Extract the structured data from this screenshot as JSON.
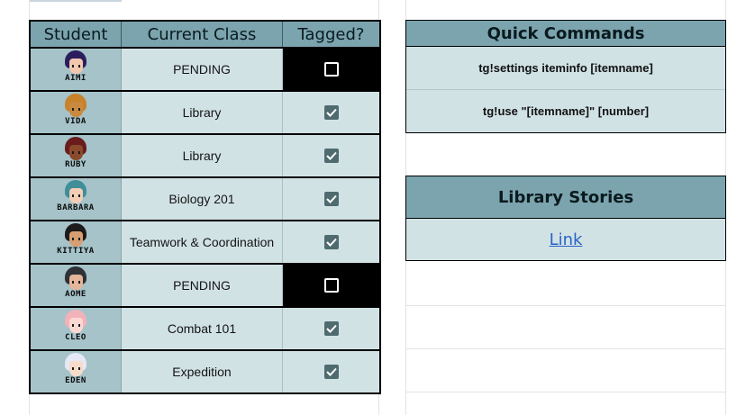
{
  "student_table": {
    "headers": {
      "student": "Student",
      "current_class": "Current Class",
      "tagged": "Tagged?"
    },
    "rows": [
      {
        "name": "AIMI",
        "current_class": "PENDING",
        "tagged": false,
        "hair_color": "#2c1e5c",
        "skin_color": "#f2c7b0"
      },
      {
        "name": "VIDA",
        "current_class": "Library",
        "tagged": true,
        "hair_color": "#c7822a",
        "skin_color": "#c98a3f"
      },
      {
        "name": "RUBY",
        "current_class": "Library",
        "tagged": true,
        "hair_color": "#6a1c1c",
        "skin_color": "#8a4a2c"
      },
      {
        "name": "BARBARA",
        "current_class": "Biology 201",
        "tagged": true,
        "hair_color": "#3f8e98",
        "skin_color": "#f3cdb6"
      },
      {
        "name": "KITTIYA",
        "current_class": "Teamwork & Coordination",
        "tagged": true,
        "hair_color": "#1c1a1a",
        "skin_color": "#d79f72"
      },
      {
        "name": "AOME",
        "current_class": "PENDING",
        "tagged": false,
        "hair_color": "#2e3136",
        "skin_color": "#e5b59a"
      },
      {
        "name": "CLEO",
        "current_class": "Combat 101",
        "tagged": true,
        "hair_color": "#f2b2b9",
        "skin_color": "#fbd9d2"
      },
      {
        "name": "EDEN",
        "current_class": "Expedition",
        "tagged": true,
        "hair_color": "#e7e8f6",
        "skin_color": "#f7dcc9"
      }
    ]
  },
  "quick_commands": {
    "title": "Quick Commands",
    "commands": [
      "tg!settings iteminfo [itemname]",
      "tg!use \"[itemname]\" [number]"
    ]
  },
  "library_stories": {
    "title": "Library Stories",
    "link_label": "Link"
  },
  "colors": {
    "header_bg": "#7ba4ae",
    "cell_bg": "#d1e2e5",
    "avatar_bg": "#a5c3c9",
    "checkbox_checked": "#4f6b6f",
    "link": "#2a63c6"
  }
}
